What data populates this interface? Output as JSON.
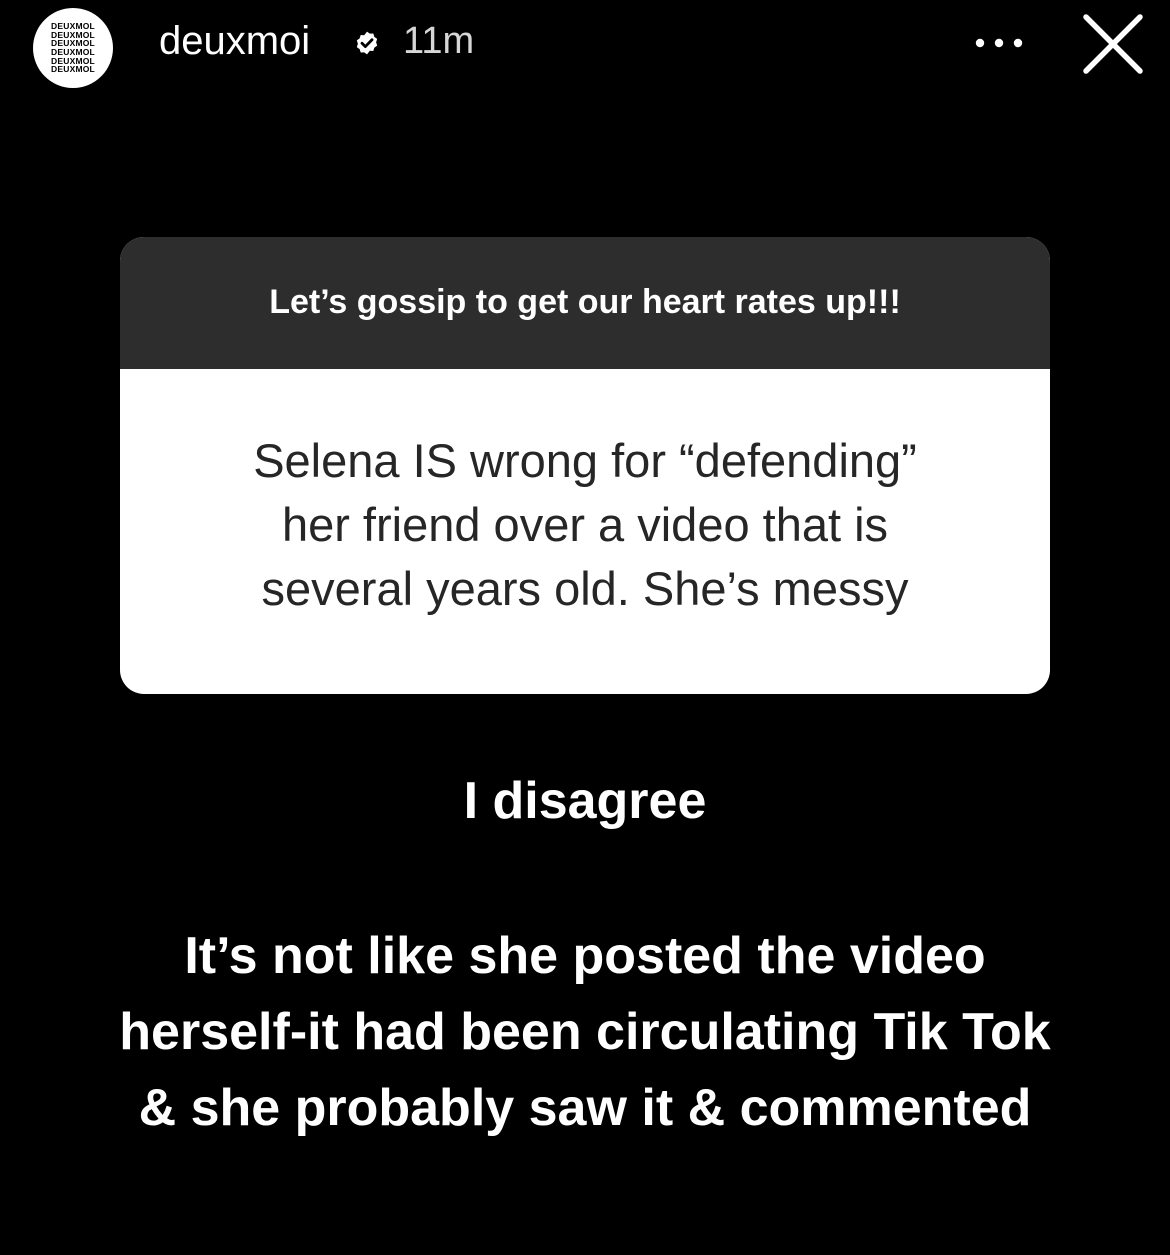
{
  "header": {
    "avatar_logo_lines": [
      "DEUXMOL",
      "DEUXMOL",
      "DEUXMOL",
      "DEUXMOL",
      "DEUXMOL",
      "DEUXMOL"
    ],
    "username": "deuxmoi",
    "verified_icon": "verified-badge-icon",
    "time": "11m",
    "more_icon": "more-options-icon",
    "close_icon": "close-icon"
  },
  "question_card": {
    "prompt": "Let’s gossip to get our heart rates up!!!",
    "answer_lines": [
      "Selena IS wrong for “defending”",
      "her friend over a video that is",
      "several years old. She’s messy"
    ]
  },
  "reply": {
    "short": "I disagree",
    "long_lines": [
      "It’s not like she posted the video",
      "herself-it had been circulating Tik Tok",
      "& she probably saw it & commented"
    ]
  },
  "colors": {
    "background": "#000000",
    "prompt_bar": "#2d2d2d",
    "card": "#ffffff",
    "card_text": "#262626",
    "text": "#ffffff"
  }
}
